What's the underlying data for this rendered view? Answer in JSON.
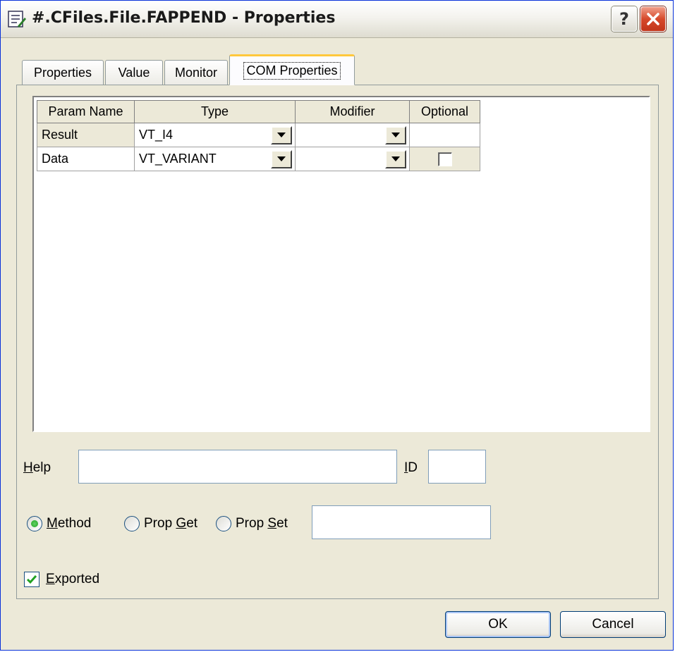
{
  "window": {
    "title": "#.CFiles.File.FAPPEND - Properties",
    "help_glyph": "?",
    "icon": "properties-sheet-icon"
  },
  "tabs": [
    {
      "label": "Properties",
      "active": false
    },
    {
      "label": "Value",
      "active": false
    },
    {
      "label": "Monitor",
      "active": false
    },
    {
      "label": "COM Properties",
      "active": true
    }
  ],
  "grid": {
    "headers": [
      "Param Name",
      "Type",
      "Modifier",
      "Optional"
    ],
    "rows": [
      {
        "name": "Result",
        "type": "VT_I4",
        "modifier": "",
        "optional_checked": null
      },
      {
        "name": "Data",
        "type": "VT_VARIANT",
        "modifier": "",
        "optional_checked": false
      }
    ]
  },
  "form": {
    "help_prefix": "H",
    "help_rest": "elp",
    "help_value": "",
    "id_prefix": "I",
    "id_rest": "D",
    "id_value": "",
    "radio_method": {
      "prefix": "",
      "accel": "M",
      "rest": "ethod",
      "checked": true
    },
    "radio_propget": {
      "prefix": "Prop ",
      "accel": "G",
      "rest": "et",
      "checked": false
    },
    "radio_propset": {
      "prefix": "Prop ",
      "accel": "S",
      "rest": "et",
      "checked": false
    },
    "prop_value": "",
    "exported": {
      "accel": "E",
      "rest": "xported",
      "checked": true
    }
  },
  "buttons": {
    "ok": "OK",
    "cancel": "Cancel"
  },
  "colors": {
    "titlebar_border": "#0831d9",
    "dialog_bg": "#ece9d8",
    "tab_active_top": "#ffc83c",
    "close_red": "#d6492b",
    "radio_green": "#21a121"
  }
}
